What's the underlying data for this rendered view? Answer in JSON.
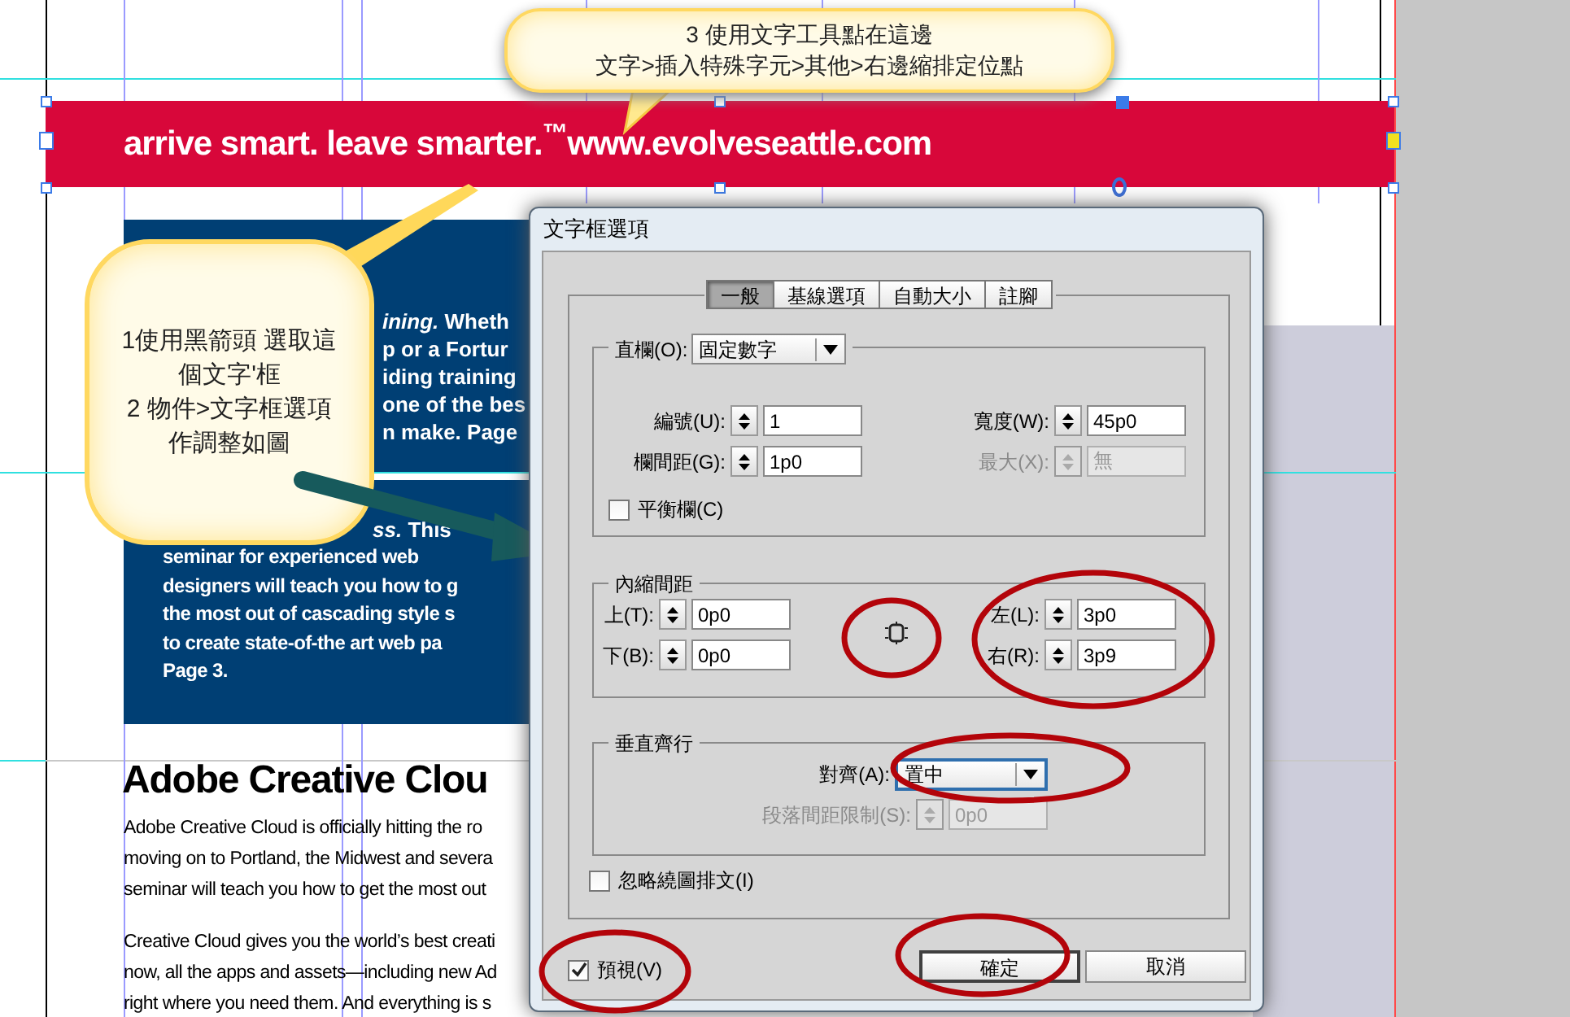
{
  "document": {
    "banner": "arrive smart. leave smarter.$^{™}$www.evolveseattle.com",
    "blue_box": {
      "upper_lines": [
        "*ining.* Wheth",
        "p or a Fortur",
        "iding training",
        "one of the bes",
        "n make. Page"
      ],
      "lower_first": "*ss.* This",
      "lower_lines": [
        "seminar for experienced web",
        "designers will teach you how to g",
        "the most out of cascading style s",
        "to create state-of-the art web pa",
        "Page 3."
      ]
    },
    "heading": "Adobe Creative Clou",
    "paragraphs": [
      [
        "Adobe Creative Cloud is officially hitting the ro",
        "moving on to Portland, the Midwest and severa",
        "seminar will teach you how to get the most out"
      ],
      [
        "Creative Cloud gives you the world’s best creati",
        "now, all the apps and assets—including new Ad",
        "right where you need them. And everything is s"
      ]
    ]
  },
  "callouts": [
    {
      "lines": [
        "3 使用文字工具點在這邊",
        "文字>插入特殊字元>其他>右邊縮排定位點"
      ]
    },
    {
      "lines": [
        "1使用黑箭頭 選取這",
        "個文字'框",
        "2 物件>文字框選項",
        "作調整如圖"
      ]
    }
  ],
  "dialog": {
    "title": "文字框選項",
    "tabs": [
      {
        "label": "一般",
        "selected": true
      },
      {
        "label": "基線選項",
        "selected": false
      },
      {
        "label": "自動大小",
        "selected": false
      },
      {
        "label": "註腳",
        "selected": false
      }
    ],
    "columns": {
      "label": "直欄(O):",
      "value": "固定數字",
      "fields": [
        {
          "label": "編號(U):",
          "value": "1",
          "disabled": false
        },
        {
          "label": "寬度(W):",
          "value": "45p0",
          "disabled": false
        },
        {
          "label": "欄間距(G):",
          "value": "1p0",
          "disabled": false
        },
        {
          "label": "最大(X):",
          "value": "無",
          "disabled": true
        }
      ],
      "balance": {
        "label": "平衡欄(C)",
        "checked": false
      }
    },
    "inset": {
      "title": "內縮間距",
      "fields": [
        {
          "label": "上(T):",
          "value": "0p0",
          "disabled": false
        },
        {
          "label": "左(L):",
          "value": "3p0",
          "disabled": false
        },
        {
          "label": "下(B):",
          "value": "0p0",
          "disabled": false
        },
        {
          "label": "右(R):",
          "value": "3p9",
          "disabled": false
        }
      ]
    },
    "vertical": {
      "title": "垂直齊行",
      "align": {
        "label": "對齊(A):",
        "value": "置中"
      },
      "spacing_limit": {
        "label": "段落間距限制(S):",
        "value": "0p0",
        "disabled": true
      }
    },
    "ignore_wrap": {
      "label": "忽略繞圖排文(I)",
      "checked": false
    },
    "preview": {
      "label": "預視(V)",
      "checked": true
    },
    "buttons": [
      {
        "label": "確定",
        "default": true
      },
      {
        "label": "取消",
        "default": false
      }
    ]
  }
}
